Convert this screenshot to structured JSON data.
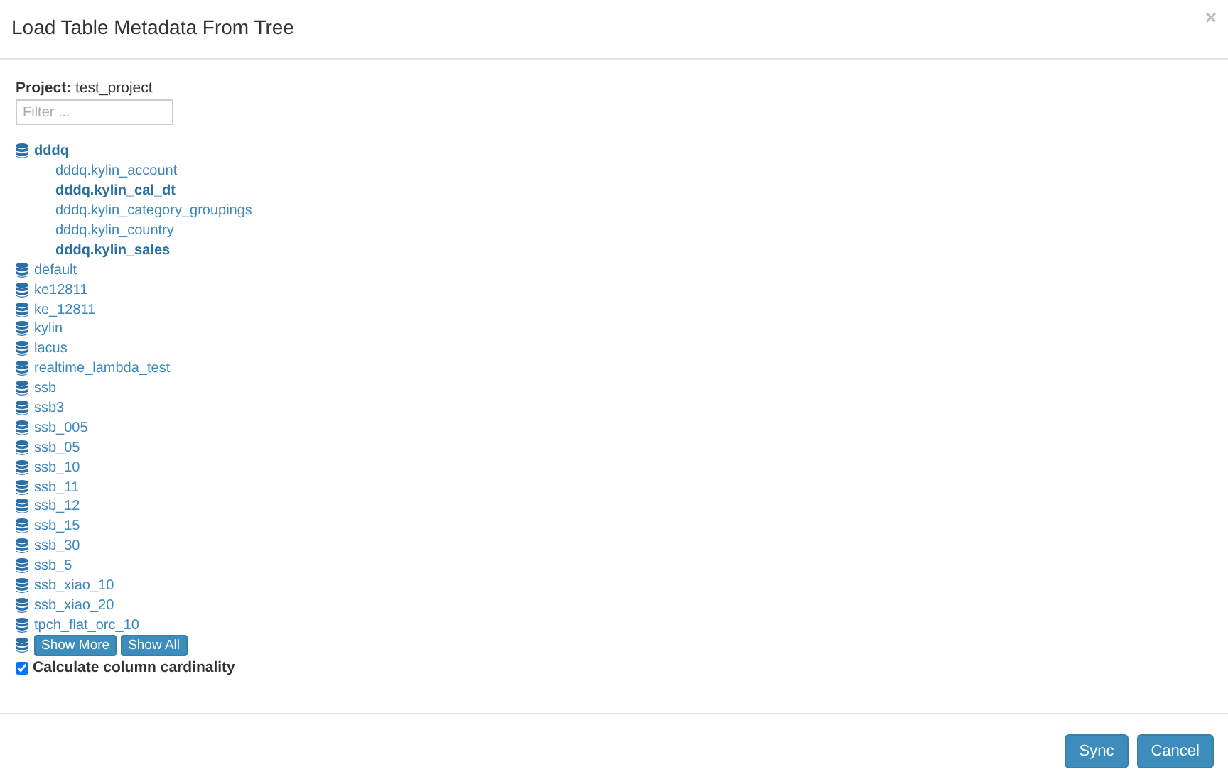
{
  "dialog": {
    "title": "Load Table Metadata From Tree",
    "close": "×"
  },
  "project": {
    "label": "Project:",
    "name": "test_project"
  },
  "filter": {
    "placeholder": "Filter ..."
  },
  "databases": [
    {
      "name": "dddq",
      "expanded": true,
      "children": [
        {
          "name": "dddq.kylin_account",
          "selected": false
        },
        {
          "name": "dddq.kylin_cal_dt",
          "selected": true
        },
        {
          "name": "dddq.kylin_category_groupings",
          "selected": false
        },
        {
          "name": "dddq.kylin_country",
          "selected": false
        },
        {
          "name": "dddq.kylin_sales",
          "selected": true
        }
      ]
    },
    {
      "name": "default",
      "expanded": false
    },
    {
      "name": "ke12811",
      "expanded": false
    },
    {
      "name": "ke_12811",
      "expanded": false
    },
    {
      "name": "kylin",
      "expanded": false
    },
    {
      "name": "lacus",
      "expanded": false
    },
    {
      "name": "realtime_lambda_test",
      "expanded": false
    },
    {
      "name": "ssb",
      "expanded": false
    },
    {
      "name": "ssb3",
      "expanded": false
    },
    {
      "name": "ssb_005",
      "expanded": false
    },
    {
      "name": "ssb_05",
      "expanded": false
    },
    {
      "name": "ssb_10",
      "expanded": false
    },
    {
      "name": "ssb_11",
      "expanded": false
    },
    {
      "name": "ssb_12",
      "expanded": false
    },
    {
      "name": "ssb_15",
      "expanded": false
    },
    {
      "name": "ssb_30",
      "expanded": false
    },
    {
      "name": "ssb_5",
      "expanded": false
    },
    {
      "name": "ssb_xiao_10",
      "expanded": false
    },
    {
      "name": "ssb_xiao_20",
      "expanded": false
    },
    {
      "name": "tpch_flat_orc_10",
      "expanded": false
    }
  ],
  "more_buttons": [
    "Show More",
    "Show All"
  ],
  "cardinality": {
    "label": "Calculate column cardinality",
    "checked": true
  },
  "buttons": [
    "Sync",
    "Cancel"
  ]
}
